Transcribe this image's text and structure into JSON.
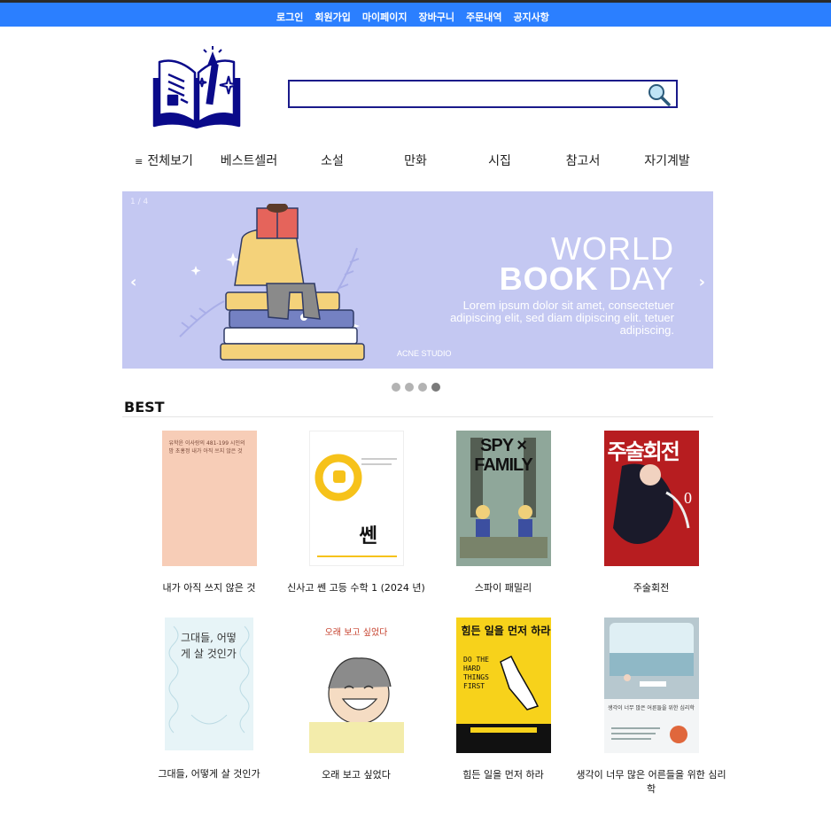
{
  "top_nav": {
    "items": [
      "로그인",
      "회원가입",
      "마이페이지",
      "장바구니",
      "주문내역",
      "공지사항"
    ]
  },
  "search": {
    "value": "",
    "placeholder": ""
  },
  "categories": {
    "all_label": "전체보기",
    "items": [
      "베스트셀러",
      "소설",
      "만화",
      "시집",
      "참고서",
      "자기계발"
    ]
  },
  "banner": {
    "counter": "1 / 4",
    "prev_label": "‹",
    "next_label": "›",
    "headline_1": "WORLD",
    "headline_2_bold": "BOOK",
    "headline_2_rest": " DAY",
    "body": "Lorem ipsum dolor sit amet, consectetuer adipiscing elit, sed diam dipiscing elit. tetuer adipiscing.",
    "studio": "ACNE STUDIO",
    "dots_total": 4,
    "dots_active_index": 3,
    "colors": {
      "background": "#c4c8f2"
    }
  },
  "best": {
    "title": "BEST",
    "books": [
      {
        "title": "내가 아직 쓰지 않은 것",
        "cover_text": "유학윤 이사랑의 481-199 시인의 밤 초홍정 내가 아직 쓰지 않은 것",
        "cover_color": "#f7cdb7"
      },
      {
        "title": "신사고 쎈 고등 수학 1 (2024 년)",
        "cover_text": "쎈",
        "cover_color": "#ffffff"
      },
      {
        "title": "스파이 패밀리",
        "cover_text": "SPY × FAMILY",
        "cover_color": "#8fa79a"
      },
      {
        "title": "주술회전",
        "cover_text": "주술회전",
        "cover_color": "#b71d20"
      },
      {
        "title": "그대들, 어떻게 살 것인가",
        "cover_text": "그대들, 어떻게 살 것인가",
        "cover_color": "#e7f4f7"
      },
      {
        "title": "오래 보고 싶었다",
        "cover_text": "오래 보고 싶었다",
        "cover_color": "#ffffff"
      },
      {
        "title": "힘든 일을 먼저 하라",
        "cover_text": "힘든 일을 먼저 하라",
        "cover_color": "#f7d21b"
      },
      {
        "title": "생각이 너무 많은 어른들을 위한 심리학",
        "cover_text": "생각이 너무 많은 어른들을 위한 심리학",
        "cover_color": "#dfe7ea"
      }
    ]
  },
  "colors": {
    "top_bar": "#2b7fff",
    "search_border": "#1a1a8a",
    "logo": "#0a0a8a"
  }
}
